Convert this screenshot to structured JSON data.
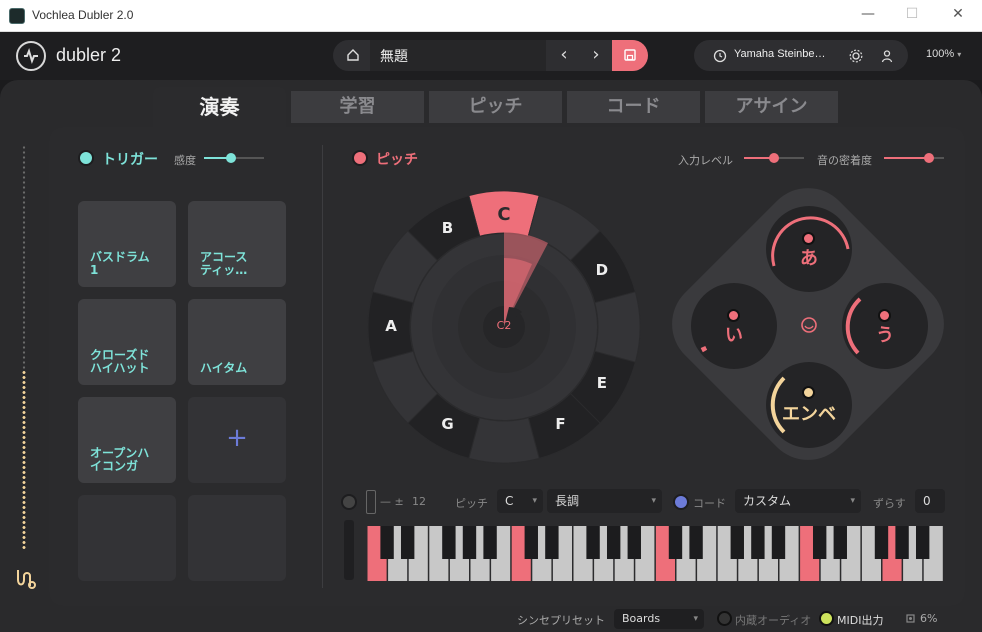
{
  "window": {
    "title": "Vochlea Dubler 2.0",
    "minimize": "—",
    "maximize": "☐",
    "close": "✕"
  },
  "header": {
    "logo_text": "dubler 2",
    "preset_name": "無題",
    "prev": "‹",
    "next": "›",
    "device": "Yamaha Steinbe…",
    "zoom": "100%"
  },
  "tabs": [
    {
      "label": "演奏"
    },
    {
      "label": "学習"
    },
    {
      "label": "ピッチ"
    },
    {
      "label": "コード"
    },
    {
      "label": "アサイン"
    }
  ],
  "trigger": {
    "title": "トリガー",
    "sensitivity_label": "感度",
    "sensitivity": 0.45,
    "pads": [
      {
        "label": "バスドラム\n1"
      },
      {
        "label": "アコース\nティッ…"
      },
      {
        "label": "クローズド\nハイハット"
      },
      {
        "label": "ハイタム"
      },
      {
        "label": "オープンハ\nイコンガ"
      },
      {
        "label": "+"
      },
      {
        "label": ""
      },
      {
        "label": ""
      }
    ]
  },
  "pitch": {
    "title": "ピッチ",
    "input_level_label": "入力レベル",
    "input_level": 0.5,
    "density_label": "音の密着度",
    "density": 0.75,
    "wheel_notes": [
      "C",
      "D",
      "E",
      "F",
      "G",
      "A",
      "B"
    ],
    "current_note": "C2"
  },
  "vowels": {
    "top": "あ",
    "left": "い",
    "right": "う",
    "bottom": "エンベ",
    "center_icon": "mouth-icon"
  },
  "bottom": {
    "minus_plus": "—  ±",
    "semitones": "12",
    "pitch_label": "ピッチ",
    "key": "C",
    "scale": "長調",
    "chord_label": "コード",
    "chord": "カスタム",
    "shift_label": "ずらす",
    "shift": "0"
  },
  "keyboard": {
    "highlight_color": "#ee6f7a",
    "highlighted_white": [
      0,
      7,
      14,
      21,
      25
    ]
  },
  "footer": {
    "synth_preset_label": "シンセプリセット",
    "synth_preset": "Boards",
    "internal_audio": "内蔵オーディオ",
    "midi_out": "MIDI出力",
    "cpu": "6%"
  },
  "colors": {
    "accent": "#ee6f7a",
    "teal": "#7ee3d9",
    "envelope": "#f3d49b",
    "chord_blue": "#6c7bd8",
    "midi_green": "#cde35c"
  }
}
